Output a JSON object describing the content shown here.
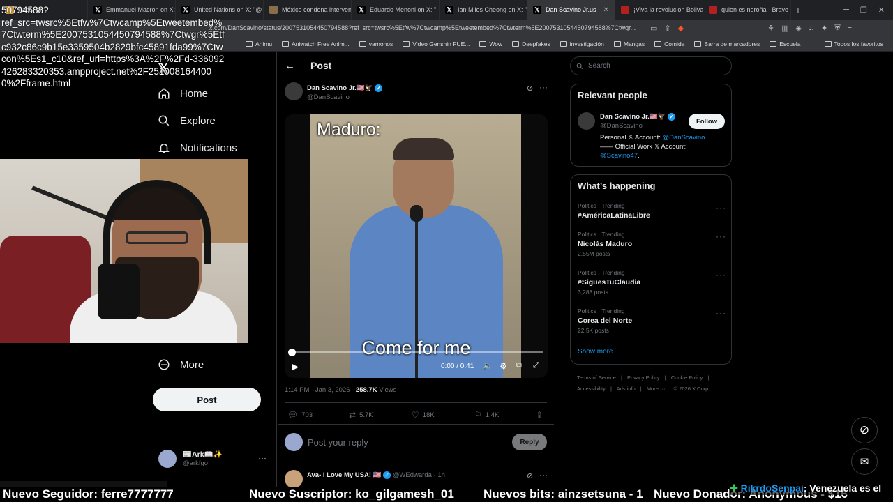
{
  "browser": {
    "tabs": [
      {
        "label": "Kast Rist",
        "color": "#d9a441",
        "active": false
      },
      {
        "label": "Emmanuel Macron on X: \"",
        "color": "#000000",
        "active": false
      },
      {
        "label": "United Nations on X: \"@",
        "color": "#000000",
        "active": false
      },
      {
        "label": "México condena interven",
        "color": "#8a6d4b",
        "active": false
      },
      {
        "label": "Eduardo Menoni on X: \"",
        "color": "#000000",
        "active": false
      },
      {
        "label": "Ian Miles Cheong on X: \"",
        "color": "#000000",
        "active": false
      },
      {
        "label": "Dan Scavino Jr.us",
        "color": "#000000",
        "active": true
      },
      {
        "label": "¡Viva la revolución Bolivar",
        "color": "#b32020",
        "active": false
      },
      {
        "label": "quien es noroña - Brave S",
        "color": "#b32020",
        "active": false
      }
    ],
    "url": "x.com/DanScavino/status/2007531054450794588?ref_src=twsrc%5Etfw%7Ctwcamp%5Etweetembed%7Ctwterm%5E2007531054450794588%7Ctwgr...",
    "bookmarks": [
      "Animu",
      "Aniwatch Free Anim...",
      "vamonos",
      "Video Genshin FUE...",
      "Wow",
      "Deepfakes",
      "investigación",
      "Mangas",
      "Comida",
      "Barra de marcadores",
      "Escuela"
    ],
    "bookmarks_right": "Todos los favoritos"
  },
  "overlay_url": "50794588?\nref_src=twsrc%5Etfw%7Ctwcamp%5Etweetembed%7Ctwterm%5E2007531054450794588%7Ctwgr%5Etfc932c86c9b15e3359504b2829bfc45891fda99%7Ctwcon%5Es1_c10&ref_url=https%3A%2F%2Fd-336092426283320353.ampproject.net%2F2510081644000%2Fframe.html",
  "nav": {
    "home": "Home",
    "explore": "Explore",
    "notifications": "Notifications",
    "more": "More",
    "post_button": "Post",
    "account_name": "📰Ark📖✨",
    "account_handle": "@arkfgo"
  },
  "post": {
    "header_title": "Post",
    "author_name": "Dan Scavino Jr.🇺🇸🦅",
    "author_handle": "@DanScavino",
    "video_caption_top": "Maduro:",
    "video_caption_bottom": "Come for me",
    "video_time": "0:00 / 0:41",
    "video_progress": 0,
    "timestamp": "1:14 PM · Jan 3, 2026 · ",
    "views_count": "258.7K",
    "views_label": " Views",
    "replies": "703",
    "reposts": "5.7K",
    "likes": "18K",
    "bookmarks": "1.4K",
    "reply_placeholder": "Post your reply",
    "reply_button": "Reply",
    "next_reply_name": "Ava- I Love My USA! 🇺🇸",
    "next_reply_handle": "@WEdwarda · 1h"
  },
  "sidebar": {
    "search_placeholder": "Search",
    "relevant_title": "Relevant people",
    "person_name": "Dan Scavino Jr.🇺🇸🦅",
    "person_handle": "@DanScavino",
    "follow_label": "Follow",
    "bio_line1": "Personal 𝕏 Account: ",
    "bio_link1": "@DanScavino",
    "bio_line2": "—— Official Work 𝕏 Account:",
    "bio_link2": "@Scavino47",
    "bio_end": ".",
    "happening_title": "What’s happening",
    "trends": [
      {
        "category": "Politics · Trending",
        "name": "#AméricaLatinaLibre",
        "count": ""
      },
      {
        "category": "Politics · Trending",
        "name": "Nicolás Maduro",
        "count": "2.55M posts"
      },
      {
        "category": "Politics · Trending",
        "name": "#SiguesTuClaudia",
        "count": "3,288 posts"
      },
      {
        "category": "Politics · Trending",
        "name": "Corea del Norte",
        "count": "22.5K posts"
      }
    ],
    "show_more": "Show more",
    "footer_row1": [
      "Terms of Service",
      "Privacy Policy",
      "Cookie Policy"
    ],
    "footer_row2": [
      "Accessibility",
      "Ads info",
      "More ···",
      "© 2026 X Corp."
    ]
  },
  "ticker": {
    "follower": "Nuevo Seguidor: ferre7777777",
    "subscriber": "Nuevo Suscriptor: ko_gilgamesh_01",
    "bits": "Nuevos bits: ainzsetsuna - 1",
    "donor": "Nuevo Donador: Anonymous - $16",
    "chat_user": "RikrdoSenpai",
    "chat_msg": ": Venezuela es el"
  },
  "colors": {
    "accent": "#1d9bf0",
    "background": "#000000",
    "border": "#2f3336"
  }
}
